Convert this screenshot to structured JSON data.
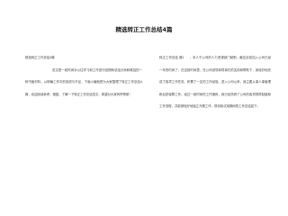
{
  "document": {
    "title": "精选转正工作总结4篇",
    "left_column": {
      "subtitle": "精选转正工作总结4篇",
      "paragraph": "范文是一段时间对以往学习和工作进行回顾和总结分析和概括的一种书面材料，以明确工作中的成绩与不足，下面小编就是为大家整理了转正工作总结4篇，欢迎阅读参考、借鉴。了解一下转正工作总结范文，希望对大家有所帮助！"
    },
    "right_column": {
      "paragraph": "转正工作总结 篇1 　 ，本人于公司的人力资源部门就职，截至目前加入公司已经一年的时间了。在这段时间里，在公司领导和同事们的支持和帮助下，我较好地完成了各项工作任务，积累了一定的工作经验。进入公司以来，我主要从事人事管理和后勤保障工作。经过一段时间的工作锻炼，我已经熟悉了公司的各项规章制度和工作流程，并能够较好地独立开展工作，现将我试用期间的工作总结如下。"
    }
  }
}
